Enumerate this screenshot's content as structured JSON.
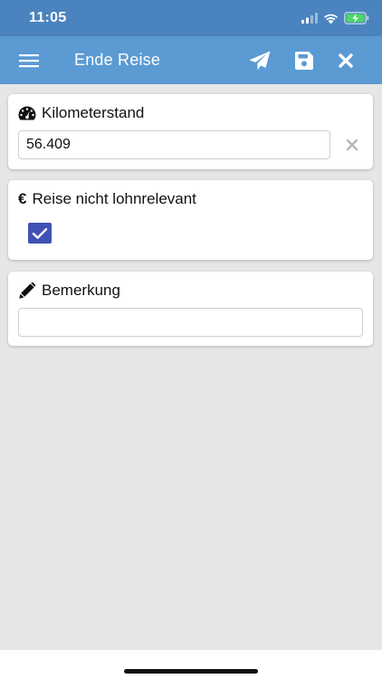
{
  "status_bar": {
    "time": "11:05",
    "icons": [
      "signal-icon",
      "wifi-icon",
      "battery-charging-icon"
    ]
  },
  "app_bar": {
    "title": "Ende Reise",
    "icons": {
      "menu": "hamburger-menu-icon",
      "send": "paper-plane-icon",
      "save": "floppy-disk-icon",
      "close": "close-icon"
    }
  },
  "kilometerstand": {
    "label": "Kilometerstand",
    "icon": "speedometer-icon",
    "value": "56.409",
    "clear_icon": "clear-x-icon"
  },
  "reise": {
    "label": "Reise nicht lohnrelevant",
    "icon_glyph": "€",
    "checked": true
  },
  "bemerkung": {
    "label": "Bemerkung",
    "icon": "pencil-icon",
    "value": ""
  },
  "colors": {
    "status_bar": "#4a83bf",
    "app_bar": "#5b9ad3",
    "background": "#e6e6e6",
    "checkbox": "#3f51b5",
    "clear_icon": "#b8b8b8"
  }
}
